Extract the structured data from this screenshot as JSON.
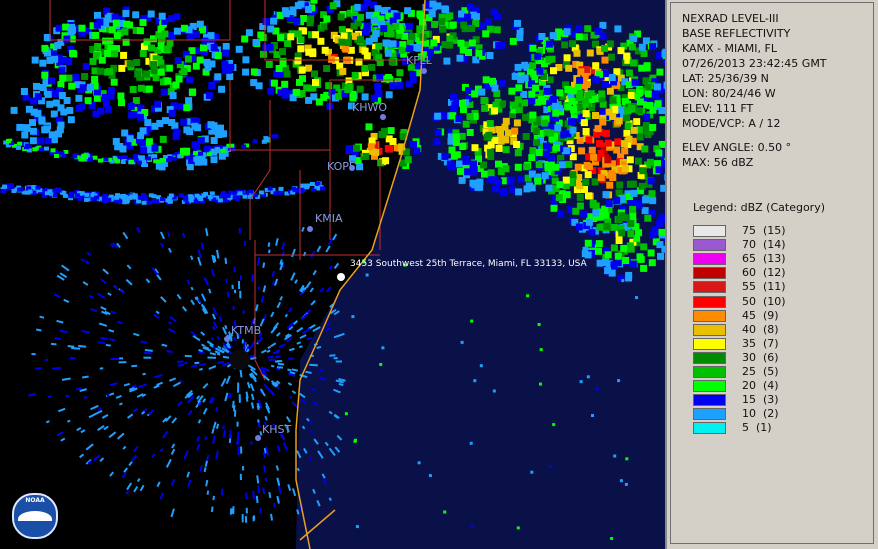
{
  "map": {
    "stations": [
      {
        "id": "KFLL"
      },
      {
        "id": "KHWO"
      },
      {
        "id": "KOPF"
      },
      {
        "id": "KMIA"
      },
      {
        "id": "KTMB"
      },
      {
        "id": "KHST"
      }
    ],
    "address": "3453 Southwest 25th Terrace, Miami, FL 33133, USA",
    "logo_text": "NOAA",
    "colors": {
      "ocean": "#0a1048",
      "coast": "#e8a020",
      "roads": "#c03030"
    }
  },
  "info": {
    "line1": "NEXRAD LEVEL-III",
    "line2": "BASE REFLECTIVITY",
    "line3": "KAMX - MIAMI, FL",
    "line4": "07/26/2013 23:42:45 GMT",
    "line5": "LAT: 25/36/39 N",
    "line6": "LON: 80/24/46 W",
    "line7": "ELEV: 111 FT",
    "line8": "MODE/VCP: A / 12",
    "line9": "ELEV ANGLE: 0.50 °",
    "line10": "MAX: 56 dBZ"
  },
  "legend": {
    "title": "Legend: dBZ (Category)",
    "entries": [
      {
        "label": "75  (15)",
        "color": "#e8e8e8"
      },
      {
        "label": "70  (14)",
        "color": "#9b59d0"
      },
      {
        "label": "65  (13)",
        "color": "#f000f0"
      },
      {
        "label": "60  (12)",
        "color": "#c00000"
      },
      {
        "label": "55  (11)",
        "color": "#d81818"
      },
      {
        "label": "50  (10)",
        "color": "#ff0000"
      },
      {
        "label": "45  (9)",
        "color": "#ff8c00"
      },
      {
        "label": "40  (8)",
        "color": "#e8c000"
      },
      {
        "label": "35  (7)",
        "color": "#ffff00"
      },
      {
        "label": "30  (6)",
        "color": "#008c00"
      },
      {
        "label": "25  (5)",
        "color": "#00c000"
      },
      {
        "label": "20  (4)",
        "color": "#00ff00"
      },
      {
        "label": "15  (3)",
        "color": "#0000f0"
      },
      {
        "label": "10  (2)",
        "color": "#1ea0ff"
      },
      {
        "label": "5  (1)",
        "color": "#00f0f0"
      }
    ]
  }
}
